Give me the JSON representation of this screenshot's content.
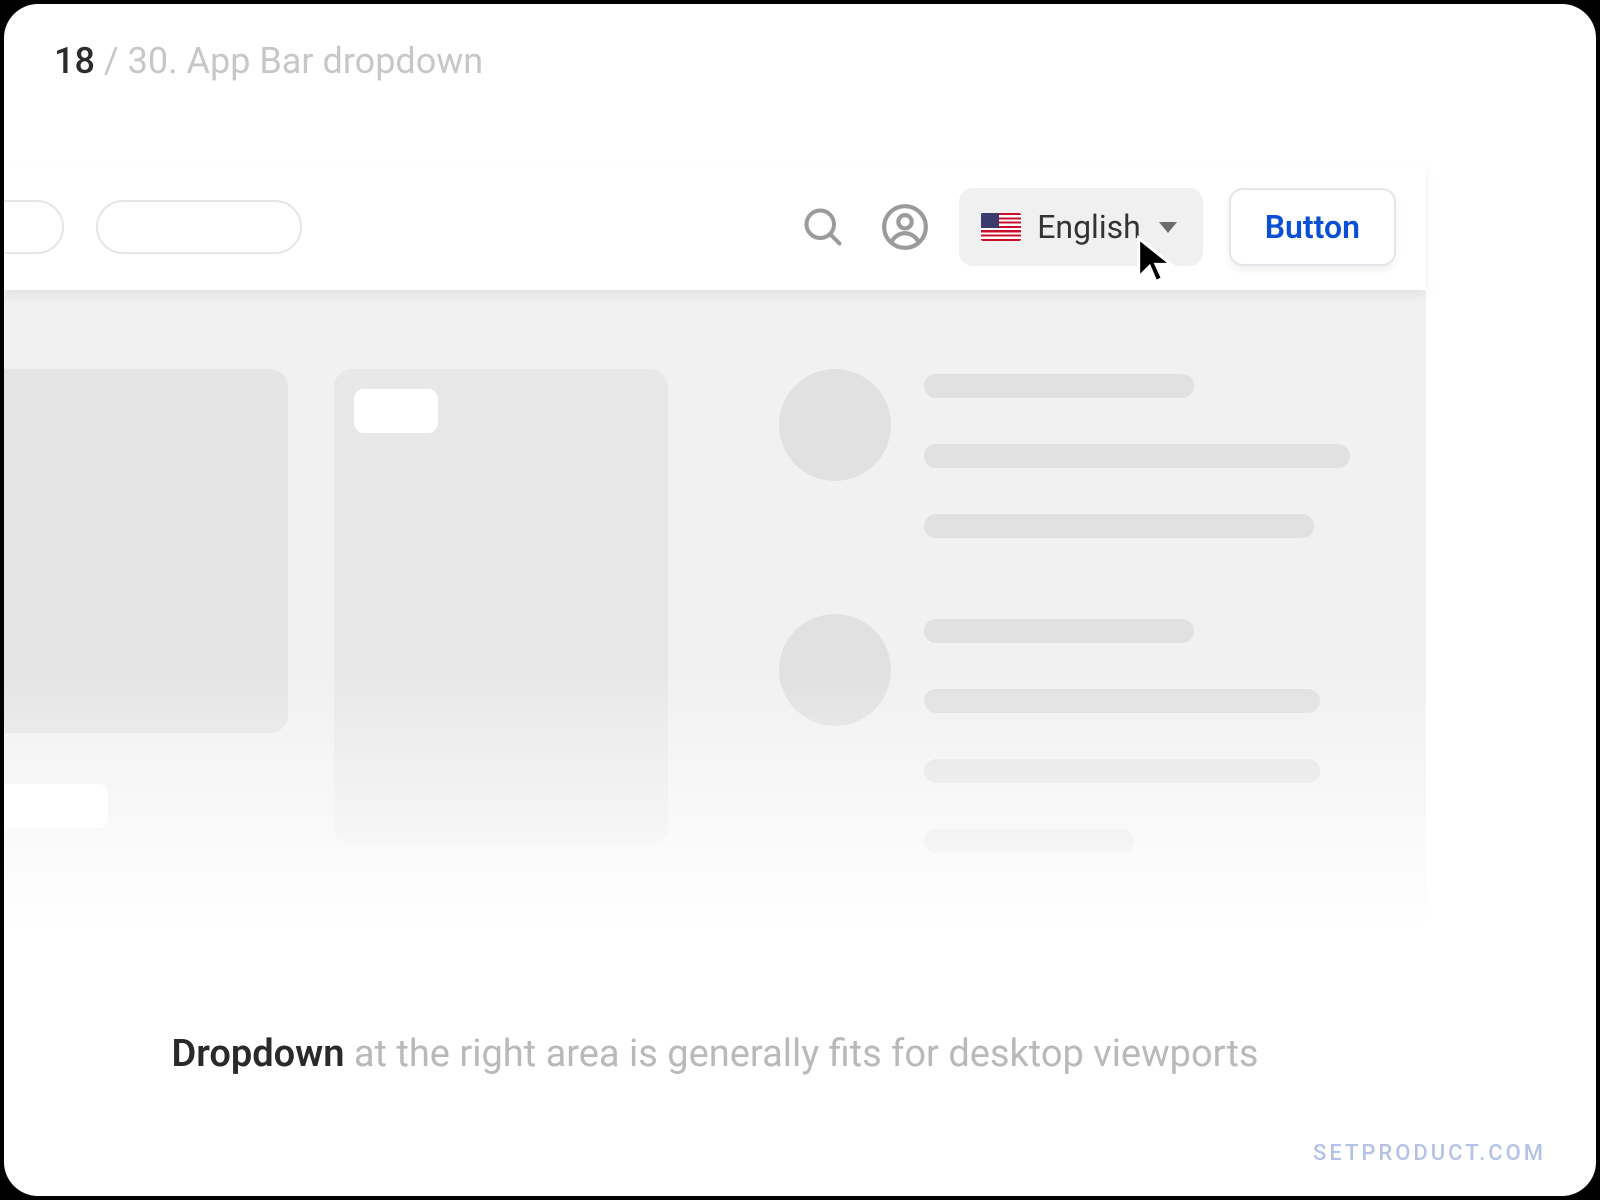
{
  "slide": {
    "index": "18",
    "separator": " / ",
    "total_and_title": "30. App Bar dropdown"
  },
  "appbar": {
    "language_dropdown": {
      "label": "English"
    },
    "cta_label": "Button"
  },
  "caption": {
    "strong": "Dropdown",
    "rest": " at the right area is generally fits for desktop viewports"
  },
  "watermark": "SETPRODUCT.COM"
}
